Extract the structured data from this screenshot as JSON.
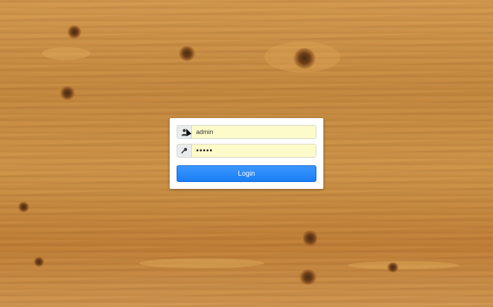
{
  "login": {
    "username_value": "admin",
    "password_value": "•••••",
    "button_label": "Login",
    "user_icon": "user-icon",
    "key_icon": "key-icon"
  },
  "colors": {
    "button": "#1a7ef5",
    "input_autofill": "#fdfbc9",
    "card": "#ffffff"
  }
}
